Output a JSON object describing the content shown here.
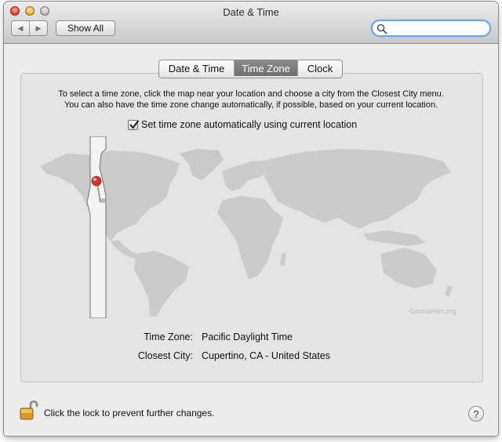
{
  "window": {
    "title": "Date & Time"
  },
  "toolbar": {
    "back_icon": "back-arrow-icon",
    "forward_icon": "forward-arrow-icon",
    "show_all_label": "Show All",
    "search_icon": "magnifier-icon",
    "search_value": ""
  },
  "tabs": [
    {
      "label": "Date & Time",
      "selected": false
    },
    {
      "label": "Time Zone",
      "selected": true
    },
    {
      "label": "Clock",
      "selected": false
    }
  ],
  "instructions": {
    "line1": "To select a time zone, click the map near your location and choose a city from the Closest City menu.",
    "line2": "You can also have the time zone change automatically, if possible, based on your current location."
  },
  "auto_timezone": {
    "label": "Set time zone automatically using current location",
    "checked": true
  },
  "map": {
    "attribution": "Geonames.org",
    "pin_icon": "map-pin-icon",
    "accent_color": "#d9342b"
  },
  "info": {
    "time_zone_label": "Time Zone:",
    "time_zone_value": "Pacific Daylight Time",
    "closest_city_label": "Closest City:",
    "closest_city_value": "Cupertino, CA - United States"
  },
  "footer": {
    "lock_icon": "unlocked-padlock-icon",
    "lock_text": "Click the lock to prevent further changes.",
    "help_label": "?"
  }
}
